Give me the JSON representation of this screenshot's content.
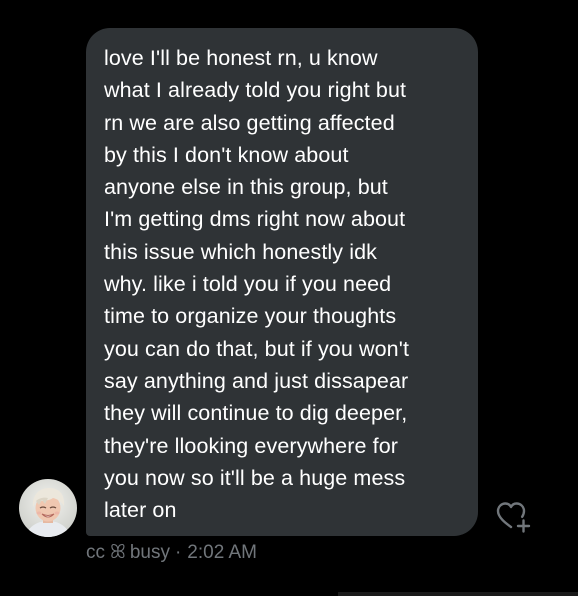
{
  "message": {
    "lines": [
      "love I'll be honest rn,  u know",
      "what I already told you right but",
      "rn we are also getting affected",
      "by this I don't know about",
      "anyone else in this group,  but",
      "I'm getting dms right now about",
      "this issue which honestly idk",
      "why. like i told you if you need",
      "time to organize your thoughts",
      "you can do that, but if you won't",
      "say anything and just dissapear",
      "they will continue to dig deeper,",
      "they're llooking everywhere for",
      "you now so it'll be a huge mess",
      "later on"
    ]
  },
  "sender": {
    "name_part1": "cc",
    "name_symbol": "ꕤ",
    "name_part2": "busy",
    "separator": "·",
    "timestamp": "2:02 AM"
  },
  "icons": {
    "avatar": "profile-photo",
    "reaction": "heart-plus-icon"
  },
  "colors": {
    "background": "#000000",
    "bubble": "#2f3336",
    "message_text": "#ffffff",
    "meta_text": "#71767b"
  }
}
